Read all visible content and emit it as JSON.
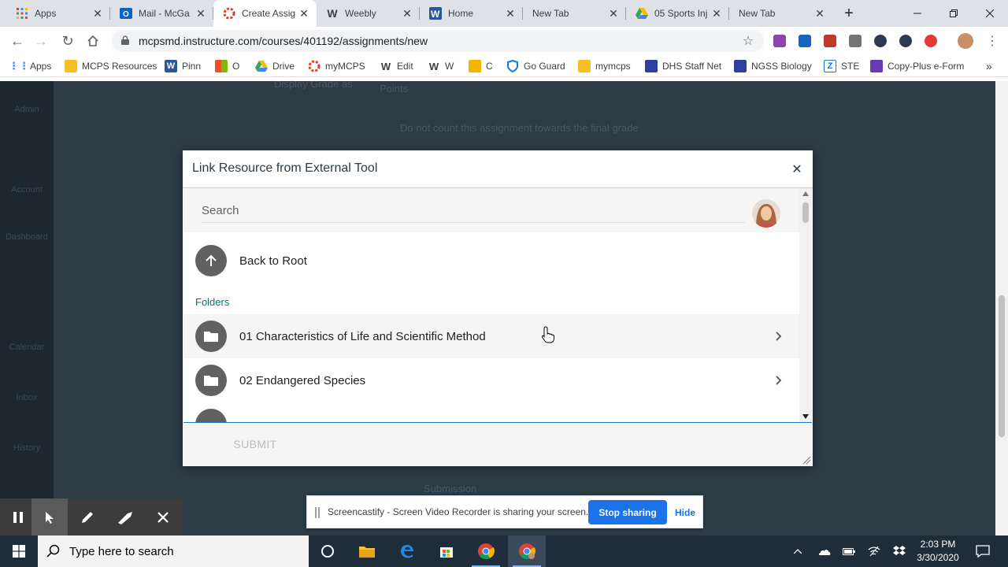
{
  "tabs": [
    {
      "title": "Apps",
      "icon": "apps-grid-icon"
    },
    {
      "title": "Mail - McGa",
      "icon": "outlook-icon"
    },
    {
      "title": "Create Assig",
      "icon": "canvas-icon"
    },
    {
      "title": "Weebly",
      "icon": "weebly-icon"
    },
    {
      "title": "Home",
      "icon": "word-icon"
    },
    {
      "title": "New Tab",
      "icon": ""
    },
    {
      "title": "05 Sports Inj",
      "icon": "drive-icon"
    },
    {
      "title": "New Tab",
      "icon": ""
    }
  ],
  "address": {
    "url": "mcpsmd.instructure.com/courses/401192/assignments/new"
  },
  "bookmarks": [
    {
      "label": "Apps",
      "icon": "apps-grid-icon"
    },
    {
      "label": "MCPS Resources",
      "icon": "folder-icon"
    },
    {
      "label": "Pinn",
      "icon": "weebly-icon"
    },
    {
      "label": "O",
      "icon": "office-icon"
    },
    {
      "label": "Drive",
      "icon": "drive-icon"
    },
    {
      "label": "myMCPS",
      "icon": "canvas-icon"
    },
    {
      "label": "Edit",
      "icon": "weebly-icon"
    },
    {
      "label": "W",
      "icon": "weebly-icon"
    },
    {
      "label": "C",
      "icon": "classroom-icon"
    },
    {
      "label": "Go Guard",
      "icon": "shield-icon"
    },
    {
      "label": "mymcps",
      "icon": "bag-icon"
    },
    {
      "label": "DHS Staff Net",
      "icon": "site-icon"
    },
    {
      "label": "NGSS Biology",
      "icon": "site-icon"
    },
    {
      "label": "STE",
      "icon": "z-icon"
    },
    {
      "label": "Copy-Plus e-Form",
      "icon": "form-icon"
    }
  ],
  "background": {
    "nav": [
      "Admin",
      "Account",
      "Dashboard",
      "Calendar",
      "Inbox",
      "History"
    ],
    "text1": "Display Grade as",
    "text2": "Points",
    "text3": "Do not count this assignment towards the final grade",
    "text4": "Submission"
  },
  "modal": {
    "title": "Link Resource from External Tool",
    "search_placeholder": "Search",
    "back_label": "Back to Root",
    "folders_heading": "Folders",
    "folders": [
      {
        "name": "01 Characteristics of Life and Scientific Method"
      },
      {
        "name": "02 Endangered Species"
      }
    ],
    "submit_label": "SUBMIT"
  },
  "screencastify": {
    "share_text": "Screencastify - Screen Video Recorder is sharing your screen.",
    "stop_label": "Stop sharing",
    "hide_label": "Hide"
  },
  "taskbar": {
    "search_placeholder": "Type here to search",
    "time": "2:03 PM",
    "date": "3/30/2020"
  },
  "colors": {
    "canvas_overlay": "#2d3b45",
    "folders_accent": "#00796b",
    "stop_button": "#1a73e8"
  }
}
